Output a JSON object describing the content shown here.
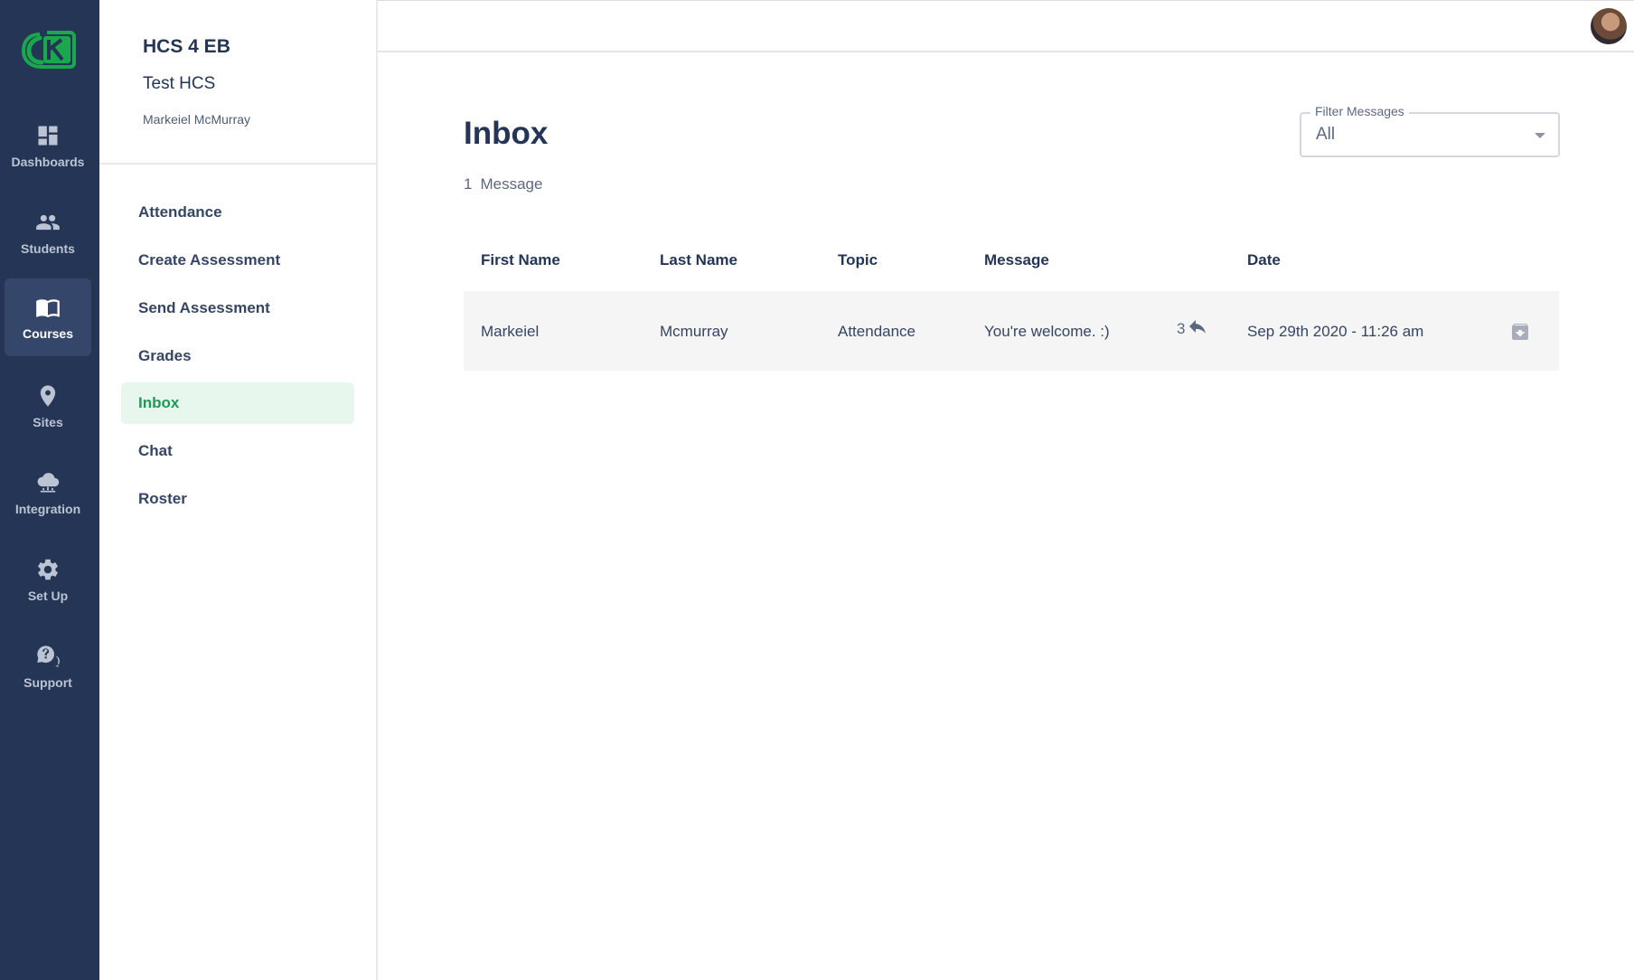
{
  "rail": {
    "items": [
      {
        "label": "Dashboards",
        "icon": "dashboard-icon"
      },
      {
        "label": "Students",
        "icon": "people-icon"
      },
      {
        "label": "Courses",
        "icon": "book-icon",
        "active": true
      },
      {
        "label": "Sites",
        "icon": "map-pin-icon"
      },
      {
        "label": "Integration",
        "icon": "cloud-network-icon"
      },
      {
        "label": "Set Up",
        "icon": "gear-icon"
      },
      {
        "label": "Support",
        "icon": "help-chat-icon"
      }
    ]
  },
  "course": {
    "title": "HCS 4 EB",
    "subtitle": "Test HCS",
    "teacher": "Markeiel McMurray",
    "nav": [
      {
        "label": "Attendance"
      },
      {
        "label": "Create Assessment"
      },
      {
        "label": "Send Assessment"
      },
      {
        "label": "Grades"
      },
      {
        "label": "Inbox",
        "active": true
      },
      {
        "label": "Chat"
      },
      {
        "label": "Roster"
      }
    ]
  },
  "inbox": {
    "title": "Inbox",
    "count": "1",
    "count_label": "Message",
    "filter": {
      "label": "Filter Messages",
      "value": "All"
    },
    "columns": {
      "first_name": "First Name",
      "last_name": "Last Name",
      "topic": "Topic",
      "message": "Message",
      "date": "Date"
    },
    "rows": [
      {
        "first_name": "Markeiel",
        "last_name": "Mcmurray",
        "topic": "Attendance",
        "message": "You're welcome. :)",
        "replies": "3",
        "date": "Sep 29th 2020 - 11:26 am"
      }
    ]
  },
  "colors": {
    "rail_bg": "#243556",
    "accent_green": "#1d9a53",
    "active_nav_bg": "#e7f7ee"
  }
}
